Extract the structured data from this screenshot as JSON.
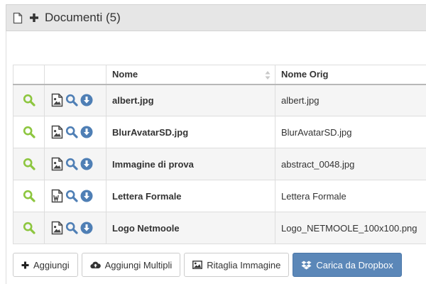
{
  "panel": {
    "title": "Documenti (5)"
  },
  "table": {
    "columns": [
      "",
      "",
      "Nome",
      "Nome Orig"
    ],
    "rows": [
      {
        "name": "albert.jpg",
        "orig": "albert.jpg",
        "type_icon": "image-file-icon"
      },
      {
        "name": "BlurAvatarSD.jpg",
        "orig": "BlurAvatarSD.jpg",
        "type_icon": "image-file-icon"
      },
      {
        "name": "Immagine di prova",
        "orig": "abstract_0048.jpg",
        "type_icon": "image-file-icon"
      },
      {
        "name": "Lettera Formale",
        "orig": "Lettera Formale",
        "type_icon": "word-file-icon"
      },
      {
        "name": "Logo Netmoole",
        "orig": "Logo_NETMOOLE_100x100.png",
        "type_icon": "image-file-icon"
      }
    ]
  },
  "buttons": {
    "add": "Aggiungi",
    "add_multiple": "Aggiungi Multipli",
    "crop": "Ritaglia Immagine",
    "dropbox": "Carica da Dropbox"
  },
  "colors": {
    "search_green": "#8dc63f",
    "action_blue": "#4f7fb5",
    "header_bg": "#e6e6e6",
    "row_alt": "#f5f5f5",
    "primary_button": "#5b87b8"
  },
  "icons": {
    "row_view": "search-icon",
    "row_preview": "search-icon",
    "row_download": "download-circle-icon",
    "header_doc": "document-icon",
    "header_add": "plus-icon",
    "sort": "sort-icon"
  }
}
